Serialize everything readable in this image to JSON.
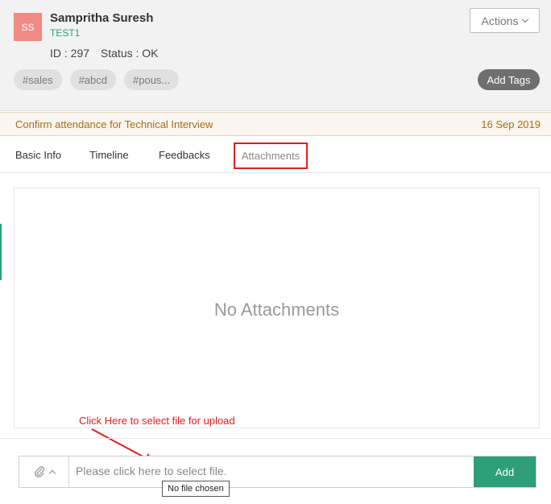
{
  "candidate": {
    "initials": "SS",
    "name": "Sampritha Suresh",
    "code": "TEST1",
    "id_label": "ID : 297",
    "status_label": "Status : OK"
  },
  "header": {
    "actions_label": "Actions",
    "tags": [
      "#sales",
      "#abcd",
      "#pous..."
    ],
    "add_tags_label": "Add Tags"
  },
  "notice": {
    "text": "Confirm attendance for Technical Interview",
    "date": "16 Sep 2019"
  },
  "tabs": {
    "basic_info": "Basic Info",
    "timeline": "Timeline",
    "feedbacks": "Feedbacks",
    "attachments": "Attachments",
    "active": "Attachments"
  },
  "content": {
    "empty_message": "No Attachments"
  },
  "annotation": {
    "hint": "Click Here to select file for upload",
    "color": "#e01e1e"
  },
  "upload": {
    "placeholder": "Please click here to select file.",
    "add_label": "Add",
    "tooltip": "No file chosen",
    "accent": "#2e9e78"
  }
}
